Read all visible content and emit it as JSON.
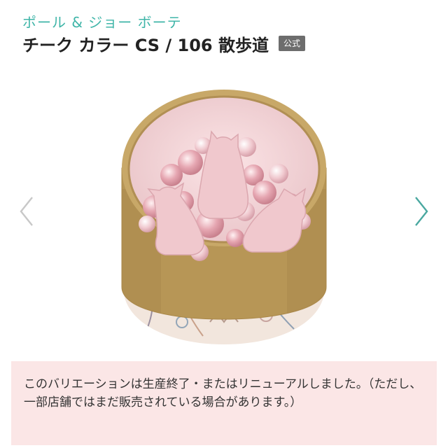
{
  "header": {
    "brand": "ポール & ジョー ボーテ",
    "product_title": "チーク カラー CS / 106 散歩道",
    "badge": "公式"
  },
  "gallery": {
    "prev_icon": "chevron-left-icon",
    "next_icon": "chevron-right-icon",
    "image_subject": "product-photo"
  },
  "notice": {
    "text": "このバリエーションは生産終了・またはリニューアルしました。（ただし、一部店舗ではまだ販売されている場合があります。）"
  },
  "colors": {
    "brand_teal": "#3fb5a8",
    "notice_bg": "#fbe6e6",
    "arrow": "#b8b8b8",
    "arrow_next": "#4aa8a0"
  }
}
